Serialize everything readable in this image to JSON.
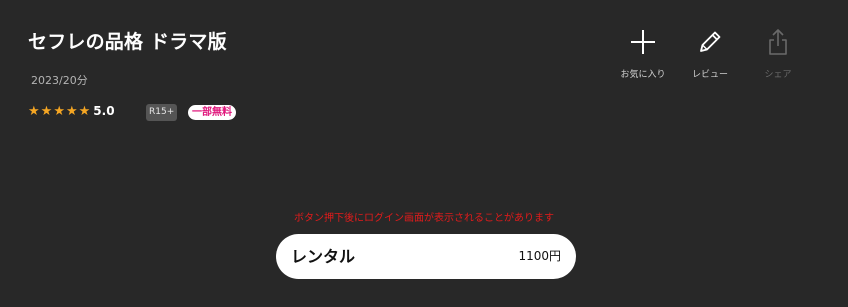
{
  "title": "セフレの品格 ドラマ版",
  "meta": "2023/20分",
  "rating": {
    "stars": 5,
    "value": "5.0"
  },
  "badges": {
    "age": "R15+",
    "free": "一部無料"
  },
  "actions": {
    "favorite": {
      "label": "お気に入り",
      "icon": "plus-icon"
    },
    "review": {
      "label": "レビュー",
      "icon": "pencil-icon"
    },
    "share": {
      "label": "シェア",
      "icon": "share-icon",
      "enabled": false
    }
  },
  "notice": "ボタン押下後にログイン画面が表示されることがあります",
  "rental": {
    "label": "レンタル",
    "price": "1100円"
  },
  "colors": {
    "background": "#282828",
    "star": "#f5a623",
    "notice": "#e11b1b",
    "free_badge_text": "#e0177c"
  }
}
